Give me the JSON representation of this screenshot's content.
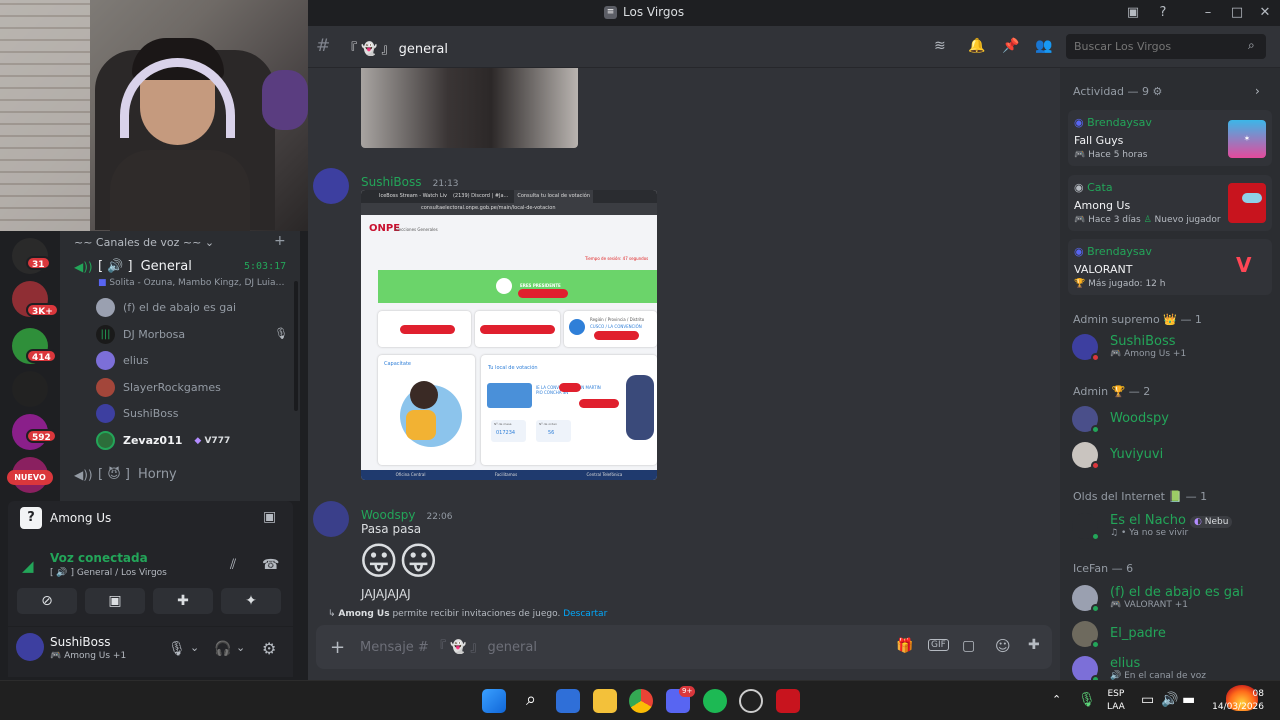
{
  "window": {
    "title": "Los Virgos"
  },
  "webcam": {
    "description": ""
  },
  "server_rail": {
    "badges": [
      "31",
      "3K+",
      "414",
      "592"
    ],
    "nuevo": "NUEVO"
  },
  "channels": {
    "category": "~~ Canales de voz ~~",
    "general": {
      "name": "General",
      "prefix": "[ 🔊 ]",
      "time": "5:03:17",
      "activity": "Solita - Ozuna, Mambo Kingz, DJ Luian..."
    },
    "users": [
      {
        "name": "(f) el de abajo es gai",
        "bright": false
      },
      {
        "name": "DJ Morbosa",
        "bright": false
      },
      {
        "name": "elius",
        "bright": false
      },
      {
        "name": "SlayerRockgames",
        "bright": false
      },
      {
        "name": "SushiBoss",
        "bright": false
      },
      {
        "name": "Zevaz011",
        "bright": true,
        "tag": "V777"
      }
    ],
    "horny": {
      "name": "Horny",
      "prefix": "[ 😈 ]"
    }
  },
  "game_panel": {
    "name": "Among Us"
  },
  "voice_panel": {
    "status": "Voz conectada",
    "location": "General / Los Virgos",
    "prefix": "[ 🔊 ]"
  },
  "user_panel": {
    "name": "SushiBoss",
    "status": "Among Us +1"
  },
  "chat_header": {
    "channel": "general",
    "prefix": "『 👻 』",
    "search_placeholder": "Buscar Los Virgos"
  },
  "messages": [
    {
      "author": "SushiBoss",
      "time": "21:13",
      "image_caption": "ONPE"
    },
    {
      "author": "Woodspy",
      "time": "22:06",
      "lines": [
        "Pasa pasa",
        "JAJAJAJAJ"
      ],
      "emoji": "😛😛"
    }
  ],
  "screenshot": {
    "tabs": [
      "IceBoss Stream - Watch Liv",
      "(2139) Discord | #Ja...",
      "Consulta tu local de votación"
    ],
    "url": "consultaelectoral.onpe.gob.pe/main/local-de-votacion",
    "brand": "ONPE",
    "brand_sub": "Elecciones Generales",
    "timer": "Tiempo de sesión: 47 segundos",
    "green_label": "ERES PRESIDENTE",
    "region_label": "Región / Provincia / Distrito",
    "region_value": "CUSCO / LA CONVENCIÓN",
    "capacitate": "Capacítate",
    "tu_local": "Tu local de votación",
    "local_name": "IE LA CONVENCIÓN SAN MARTIN PIO CONCHA SN",
    "mesa_label": "Nº de mesa",
    "mesa_value": "017234",
    "orden_label": "Nº de orden",
    "orden_value": "56",
    "footer": [
      "Oficina Central",
      "Facilitamos",
      "Central Telefónica"
    ]
  },
  "invite_notice": {
    "game": "Among Us",
    "text": "permite recibir invitaciones de juego.",
    "action": "Descartar"
  },
  "composer": {
    "placeholder": "Mensaje # 『 👻 』 general"
  },
  "members": {
    "activity_title": "Actividad — 9",
    "activity": [
      {
        "name": "Brendaysav",
        "game": "Fall Guys",
        "meta": "Hace 5 horas"
      },
      {
        "name": "Cata",
        "game": "Among Us",
        "meta": "Hace 3 días",
        "extra": "Nuevo jugador"
      },
      {
        "name": "Brendaysav",
        "game": "VALORANT",
        "meta": "Más jugado: 12 h"
      }
    ],
    "sections": [
      {
        "title": "Admin supremo",
        "count": "— 1",
        "members": [
          {
            "name": "SushiBoss",
            "sub": "Among Us +1"
          }
        ]
      },
      {
        "title": "Admin",
        "count": "— 2",
        "members": [
          {
            "name": "Woodspy",
            "sub": ""
          },
          {
            "name": "Yuviyuvi",
            "sub": ""
          }
        ]
      },
      {
        "title": "Olds del Internet",
        "count": "— 1",
        "members": [
          {
            "name": "Es el Nacho",
            "sub": "• Ya no se vivir",
            "tag": "Nebu"
          }
        ]
      },
      {
        "title": "IceFan",
        "count": "— 6",
        "members": [
          {
            "name": "(f) el de abajo es gai",
            "sub": "VALORANT +1"
          },
          {
            "name": "El_padre",
            "sub": ""
          },
          {
            "name": "elius",
            "sub": "En el canal de voz"
          }
        ]
      }
    ]
  },
  "taskbar": {
    "lang": "ESP",
    "lang2": "LAA",
    "time": "08",
    "date": "14/03/2026",
    "discord_badge": "9+"
  },
  "colors": {
    "green": "#23a559",
    "red": "#da373c",
    "blurple": "#5865f2"
  }
}
